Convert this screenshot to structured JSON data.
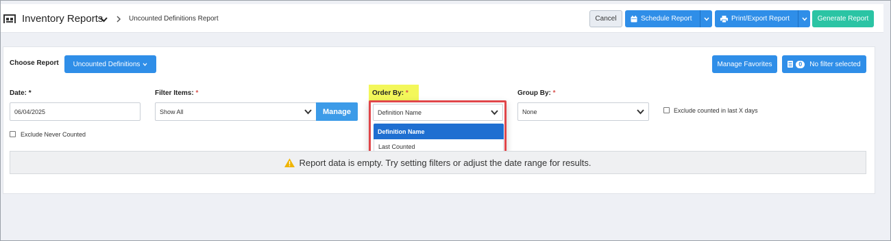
{
  "header": {
    "title": "Inventory Reports",
    "breadcrumb": "Uncounted Definitions Report",
    "icon": "warehouse-icon",
    "buttons": {
      "cancel": "Cancel",
      "schedule": "Schedule Report",
      "print_export": "Print/Export Report",
      "generate": "Generate Report"
    }
  },
  "report_picker": {
    "label": "Choose Report",
    "selected": "Uncounted Definitions"
  },
  "favorites": {
    "manage_label": "Manage Favorites",
    "filter_count": "0",
    "filter_label": "No filter selected"
  },
  "fields": {
    "date": {
      "label": "Date:",
      "required": "*",
      "value": "06/04/2025"
    },
    "filter_items": {
      "label": "Filter Items:",
      "required": "*",
      "value": "Show All",
      "manage_label": "Manage"
    },
    "order_by": {
      "label": "Order By:",
      "required": "*",
      "value": "Definition Name",
      "options": [
        "Definition Name",
        "Last Counted"
      ]
    },
    "group_by": {
      "label": "Group By:",
      "required": "*",
      "value": "None"
    },
    "exclude_counted": {
      "label": "Exclude counted in last X days",
      "checked": false
    },
    "exclude_never": {
      "label": "Exclude Never Counted",
      "checked": false
    }
  },
  "empty_message": "Report data is empty. Try setting filters or adjust the date range for results.",
  "colors": {
    "primary": "#2f8ee8",
    "generate": "#2bc4a4",
    "dropdown_selected": "#1f6fd1",
    "highlight": "#f3f75a",
    "callout_border": "#e0464a",
    "warning": "#f0b400"
  }
}
